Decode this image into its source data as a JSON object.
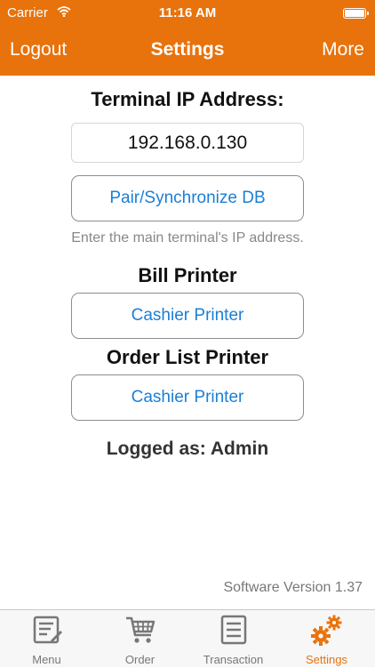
{
  "status": {
    "carrier": "Carrier",
    "time": "11:16 AM"
  },
  "nav": {
    "left": "Logout",
    "title": "Settings",
    "right": "More"
  },
  "terminal": {
    "heading": "Terminal IP Address:",
    "ip_value": "192.168.0.130",
    "pair_button": "Pair/Synchronize DB",
    "hint": "Enter the main terminal's IP address."
  },
  "bill_printer": {
    "heading": "Bill Printer",
    "button": "Cashier Printer"
  },
  "order_list_printer": {
    "heading": "Order List Printer",
    "button": "Cashier Printer"
  },
  "logged_as": "Logged as: Admin",
  "version": "Software Version 1.37",
  "tabs": [
    {
      "label": "Menu",
      "icon": "menu-icon"
    },
    {
      "label": "Order",
      "icon": "cart-icon"
    },
    {
      "label": "Transaction",
      "icon": "transaction-icon"
    },
    {
      "label": "Settings",
      "icon": "gears-icon",
      "active": true
    }
  ],
  "colors": {
    "accent": "#e8720c",
    "link": "#1a7fd6",
    "muted": "#888888"
  }
}
